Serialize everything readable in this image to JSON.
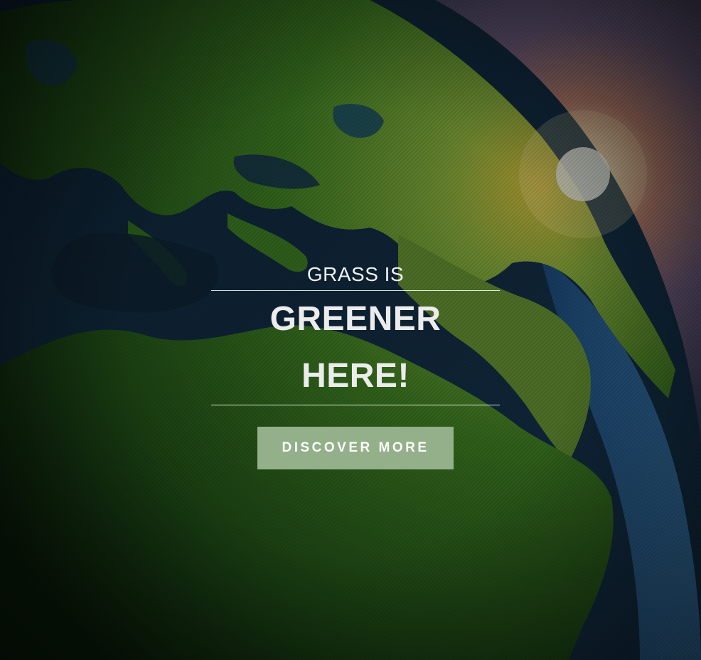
{
  "hero": {
    "kicker": "GRASS IS",
    "headline": "GREENER HERE!",
    "cta_label": "DISCOVER MORE"
  },
  "colors": {
    "cta_background": "#94b08a",
    "text": "#ececec"
  }
}
